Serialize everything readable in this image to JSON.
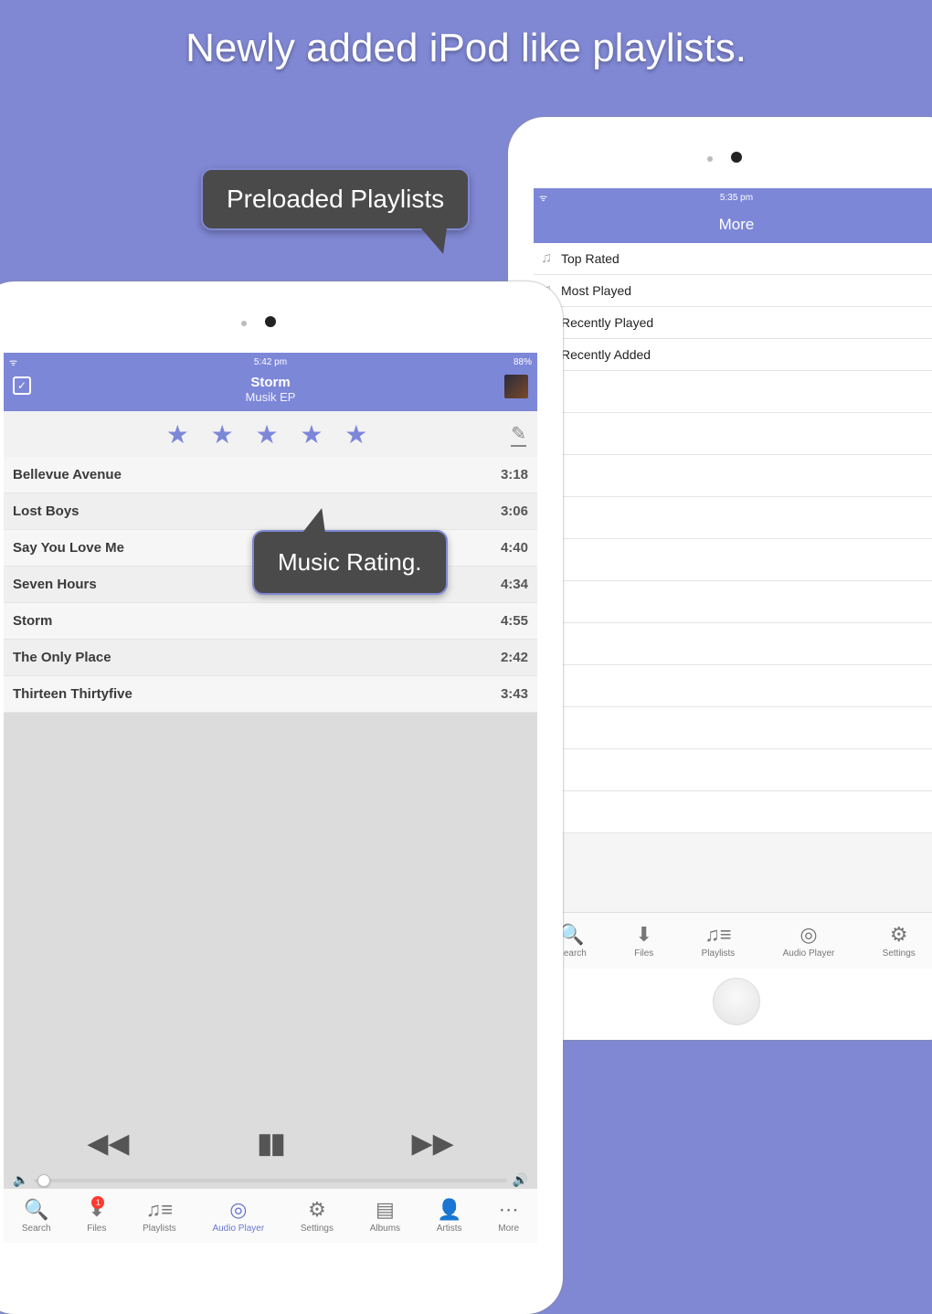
{
  "headline": "Newly added iPod like playlists.",
  "callouts": {
    "preloaded": "Preloaded Playlists",
    "rating": "Music Rating."
  },
  "status": {
    "time_a": "5:42 pm",
    "batt_a": "88%",
    "time_b": "5:35 pm"
  },
  "player": {
    "title": "Storm",
    "subtitle": "Musik EP",
    "stars": "★ ★ ★ ★ ★",
    "tracks": [
      {
        "name": "Bellevue Avenue",
        "dur": "3:18"
      },
      {
        "name": "Lost Boys",
        "dur": "3:06"
      },
      {
        "name": "Say You Love Me",
        "dur": "4:40"
      },
      {
        "name": "Seven Hours",
        "dur": "4:34"
      },
      {
        "name": "Storm",
        "dur": "4:55"
      },
      {
        "name": "The Only Place",
        "dur": "2:42"
      },
      {
        "name": "Thirteen Thirtyfive",
        "dur": "3:43"
      }
    ]
  },
  "tabs_a": [
    {
      "label": "Search"
    },
    {
      "label": "Files",
      "badge": "1"
    },
    {
      "label": "Playlists"
    },
    {
      "label": "Audio Player",
      "active": true
    },
    {
      "label": "Settings"
    },
    {
      "label": "Albums"
    },
    {
      "label": "Artists"
    },
    {
      "label": "More"
    }
  ],
  "ipad_b": {
    "header": "More",
    "items": [
      "Top Rated",
      "Most Played",
      "Recently Played",
      "Recently Added"
    ],
    "tabs": [
      "Search",
      "Files",
      "Playlists",
      "Audio Player",
      "Settings"
    ]
  },
  "icons": {
    "search": "🔍",
    "download": "⬇",
    "playlist": "♫≡",
    "audio": "◎",
    "settings": "⚙",
    "albums": "▤",
    "artist": "👤",
    "more": "⋯",
    "note": "♫"
  }
}
